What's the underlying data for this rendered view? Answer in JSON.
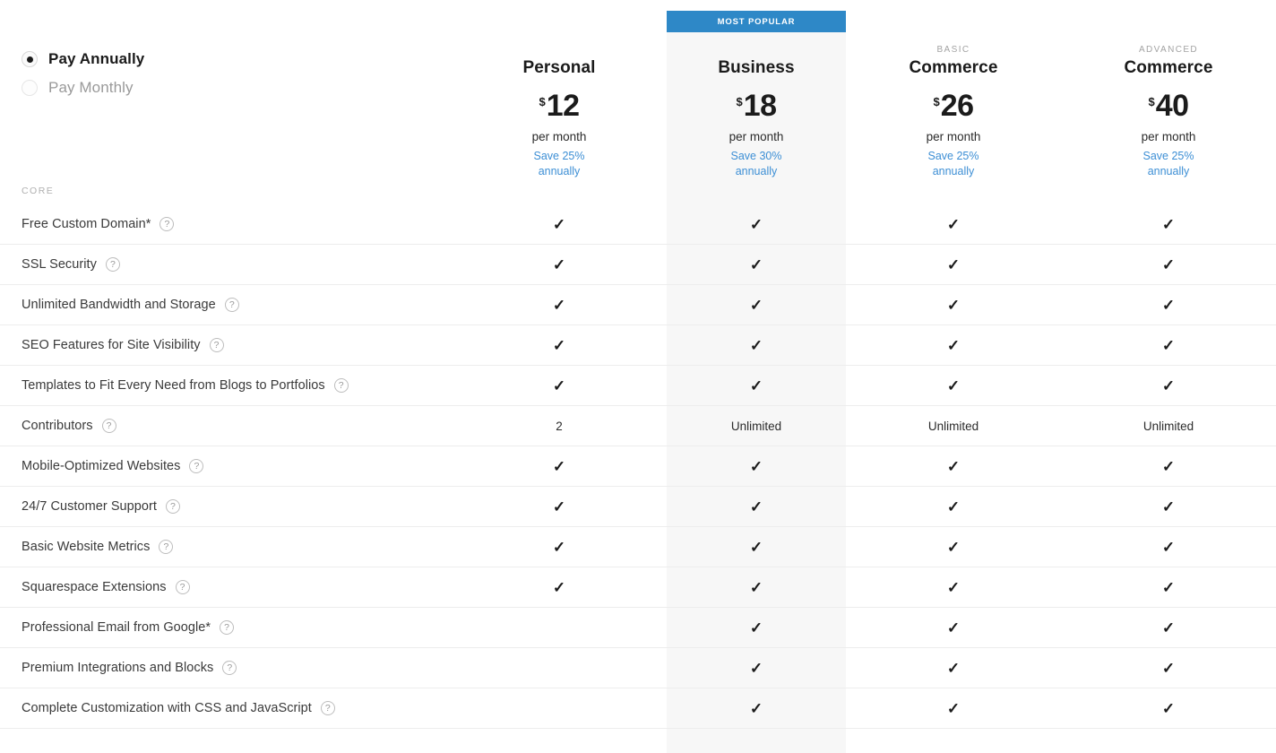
{
  "banner": {
    "label": "MOST POPULAR"
  },
  "billing": {
    "options": [
      {
        "label": "Pay Annually",
        "selected": true
      },
      {
        "label": "Pay Monthly",
        "selected": false
      }
    ]
  },
  "plans": [
    {
      "eyebrow": "",
      "name": "Personal",
      "currency": "$",
      "amount": "12",
      "period": "per month",
      "save_line1": "Save 25%",
      "save_line2": "annually",
      "highlighted": false
    },
    {
      "eyebrow": "",
      "name": "Business",
      "currency": "$",
      "amount": "18",
      "period": "per month",
      "save_line1": "Save 30%",
      "save_line2": "annually",
      "highlighted": true
    },
    {
      "eyebrow": "BASIC",
      "name": "Commerce",
      "currency": "$",
      "amount": "26",
      "period": "per month",
      "save_line1": "Save 25%",
      "save_line2": "annually",
      "highlighted": false
    },
    {
      "eyebrow": "ADVANCED",
      "name": "Commerce",
      "currency": "$",
      "amount": "40",
      "period": "per month",
      "save_line1": "Save 25%",
      "save_line2": "annually",
      "highlighted": false
    }
  ],
  "section": {
    "label": "CORE"
  },
  "help_icon_glyph": "?",
  "check_glyph": "✓",
  "features": [
    {
      "label": "Free Custom Domain*",
      "values": [
        "check",
        "check",
        "check",
        "check"
      ]
    },
    {
      "label": "SSL Security",
      "values": [
        "check",
        "check",
        "check",
        "check"
      ]
    },
    {
      "label": "Unlimited Bandwidth and Storage",
      "values": [
        "check",
        "check",
        "check",
        "check"
      ]
    },
    {
      "label": "SEO Features for Site Visibility",
      "values": [
        "check",
        "check",
        "check",
        "check"
      ]
    },
    {
      "label": "Templates to Fit Every Need from Blogs to Portfolios",
      "values": [
        "check",
        "check",
        "check",
        "check"
      ]
    },
    {
      "label": "Contributors",
      "values": [
        "2",
        "Unlimited",
        "Unlimited",
        "Unlimited"
      ]
    },
    {
      "label": "Mobile-Optimized Websites",
      "values": [
        "check",
        "check",
        "check",
        "check"
      ]
    },
    {
      "label": "24/7 Customer Support",
      "values": [
        "check",
        "check",
        "check",
        "check"
      ]
    },
    {
      "label": "Basic Website Metrics",
      "values": [
        "check",
        "check",
        "check",
        "check"
      ]
    },
    {
      "label": "Squarespace Extensions",
      "values": [
        "check",
        "check",
        "check",
        "check"
      ]
    },
    {
      "label": "Professional Email from Google*",
      "values": [
        "",
        "check",
        "check",
        "check"
      ]
    },
    {
      "label": "Premium Integrations and Blocks",
      "values": [
        "",
        "check",
        "check",
        "check"
      ]
    },
    {
      "label": "Complete Customization with CSS and JavaScript",
      "values": [
        "",
        "check",
        "check",
        "check"
      ]
    }
  ],
  "colors": {
    "accent_blue": "#2e88c7",
    "link_blue": "#3d8fd5",
    "highlight_bg": "#f7f7f7",
    "divider": "#ededed"
  }
}
